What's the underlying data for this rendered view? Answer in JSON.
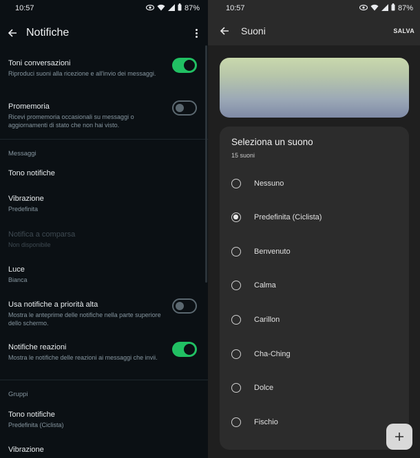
{
  "left": {
    "status": {
      "time": "10:57",
      "battery": "87%"
    },
    "header": {
      "title": "Notifiche"
    },
    "settings": [
      {
        "title": "Toni conversazioni",
        "subtitle": "Riproduci suoni alla ricezione e all'invio dei messaggi.",
        "toggle": true
      },
      {
        "title": "Promemoria",
        "subtitle": "Ricevi promemoria occasionali su messaggi o aggiornamenti di stato che non hai visto.",
        "toggle": false
      }
    ],
    "section_messages": "Messaggi",
    "messages": [
      {
        "title": "Tono notifiche"
      },
      {
        "title": "Vibrazione",
        "subtitle": "Predefinita"
      },
      {
        "title": "Notifica a comparsa",
        "subtitle": "Non disponibile",
        "disabled": true
      },
      {
        "title": "Luce",
        "subtitle": "Bianca"
      },
      {
        "title": "Usa notifiche a priorità alta",
        "subtitle": "Mostra le anteprime delle notifiche nella parte superiore dello schermo.",
        "toggle": false
      },
      {
        "title": "Notifiche reazioni",
        "subtitle": "Mostra le notifiche delle reazioni ai messaggi che invii.",
        "toggle": true
      }
    ],
    "section_groups": "Gruppi",
    "groups": [
      {
        "title": "Tono notifiche",
        "subtitle": "Predefinita (Ciclista)"
      },
      {
        "title": "Vibrazione"
      }
    ]
  },
  "right": {
    "status": {
      "time": "10:57",
      "battery": "87%"
    },
    "header": {
      "title": "Suoni",
      "save_label": "SALVA"
    },
    "sheet": {
      "title": "Seleziona un suono",
      "count": "15 suoni",
      "options": [
        {
          "label": "Nessuno",
          "selected": false
        },
        {
          "label": "Predefinita (Ciclista)",
          "selected": true
        },
        {
          "label": "Benvenuto",
          "selected": false
        },
        {
          "label": "Calma",
          "selected": false
        },
        {
          "label": "Carillon",
          "selected": false
        },
        {
          "label": "Cha-Ching",
          "selected": false
        },
        {
          "label": "Dolce",
          "selected": false
        },
        {
          "label": "Fischio",
          "selected": false
        }
      ]
    },
    "fab_icon": "add-icon"
  },
  "colors": {
    "toggle_on": "#21c063",
    "left_bg": "#0b1014",
    "right_bg": "#1f1f1f",
    "sheet_bg": "#2c2c2c"
  }
}
